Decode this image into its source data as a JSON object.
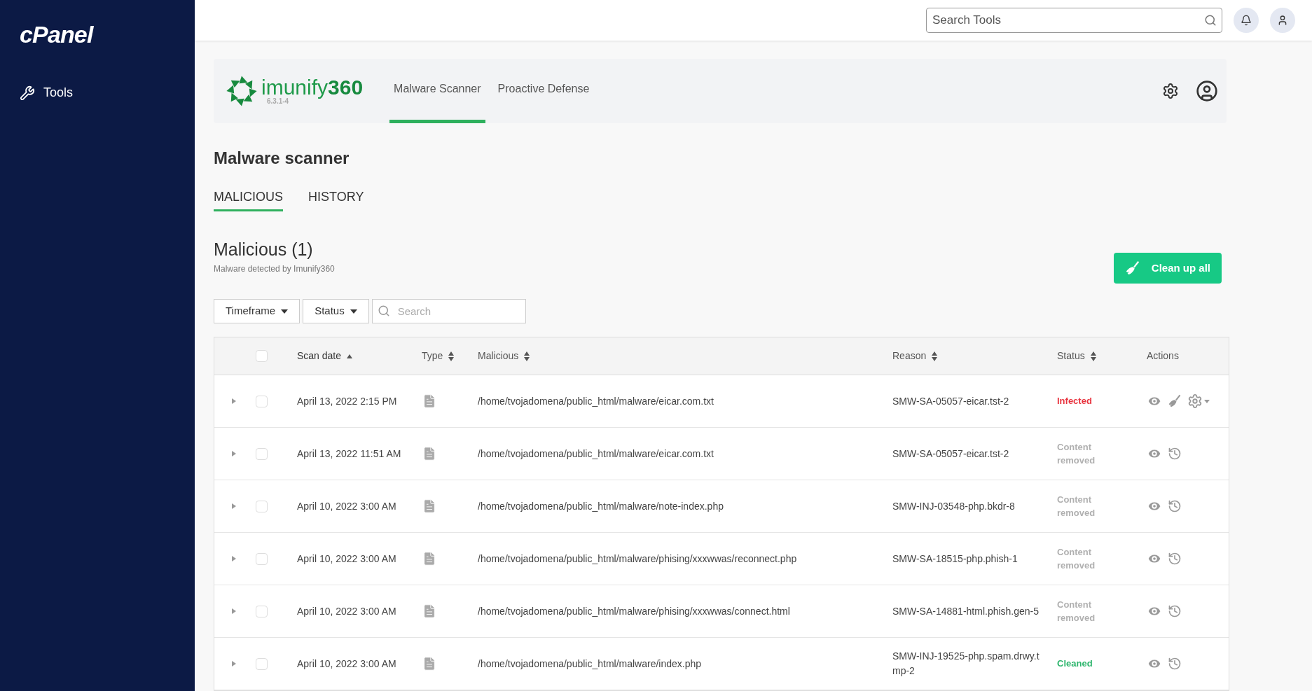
{
  "sidebar": {
    "logo": "cPanel",
    "items": [
      {
        "label": "Tools",
        "selected": false
      }
    ]
  },
  "topbar": {
    "search": {
      "placeholder": "Search Tools"
    }
  },
  "plugin": {
    "brand": "imunify",
    "brand_number": "360",
    "version": "6.3.1-4",
    "tabs": [
      {
        "label": "Malware Scanner",
        "selected": true
      },
      {
        "label": "Proactive Defense",
        "selected": false
      }
    ]
  },
  "page_title": "Malware scanner",
  "subtabs": [
    {
      "label": "MALICIOUS",
      "selected": true
    },
    {
      "label": "HISTORY",
      "selected": false
    }
  ],
  "section": {
    "title": "Malicious (1)",
    "subtitle": "Malware detected by Imunify360",
    "action": "Clean up all"
  },
  "filters": {
    "dropdowns": [
      "Timeframe",
      "Status"
    ],
    "search": {
      "placeholder": "Search"
    }
  },
  "table": {
    "select_all_checked": false,
    "columns": [
      {
        "label": "Scan date",
        "sorted": true
      },
      {
        "label": "Type",
        "sorted": false
      },
      {
        "label": "Malicious",
        "sorted": false
      },
      {
        "label": "Reason",
        "sorted": false
      },
      {
        "label": "Status",
        "sorted": false
      },
      {
        "label": "Actions"
      }
    ],
    "rows": [
      {
        "date": "April 13, 2022 2:15 PM",
        "path": "/home/tvojadomena/public_html/malware/eicar.com.txt",
        "reason": "SMW-SA-05057-eicar.tst-2",
        "status": "Infected",
        "kind": "infected",
        "checked": false
      },
      {
        "date": "April 13, 2022 11:51 AM",
        "path": "/home/tvojadomena/public_html/malware/eicar.com.txt",
        "reason": "SMW-SA-05057-eicar.tst-2",
        "status": "Content removed",
        "kind": "removed",
        "checked": false
      },
      {
        "date": "April 10, 2022 3:00 AM",
        "path": "/home/tvojadomena/public_html/malware/note-index.php",
        "reason": "SMW-INJ-03548-php.bkdr-8",
        "status": "Content removed",
        "kind": "removed",
        "checked": false
      },
      {
        "date": "April 10, 2022 3:00 AM",
        "path": "/home/tvojadomena/public_html/malware/phising/xxxwwas/reconnect.php",
        "reason": "SMW-SA-18515-php.phish-1",
        "status": "Content removed",
        "kind": "removed",
        "checked": false
      },
      {
        "date": "April 10, 2022 3:00 AM",
        "path": "/home/tvojadomena/public_html/malware/phising/xxxwwas/connect.html",
        "reason": "SMW-SA-14881-html.phish.gen-5",
        "status": "Content removed",
        "kind": "removed",
        "checked": false
      },
      {
        "date": "April 10, 2022 3:00 AM",
        "path": "/home/tvojadomena/public_html/malware/index.php",
        "reason": "SMW-INJ-19525-php.spam.drwy.tmp-2",
        "status": "Cleaned",
        "kind": "cleaned",
        "checked": false
      }
    ]
  }
}
